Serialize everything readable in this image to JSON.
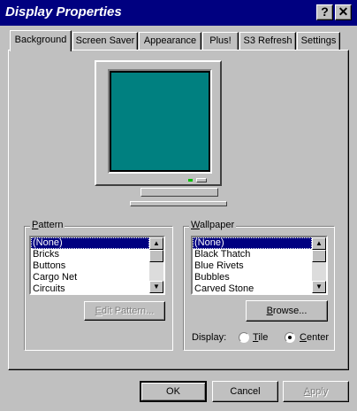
{
  "window": {
    "title": "Display Properties",
    "help_glyph": "?",
    "close_glyph": "✕"
  },
  "tabs": [
    {
      "label": "Background",
      "active": true
    },
    {
      "label": "Screen Saver",
      "active": false
    },
    {
      "label": "Appearance",
      "active": false
    },
    {
      "label": "Plus!",
      "active": false
    },
    {
      "label": "S3 Refresh",
      "active": false
    },
    {
      "label": "Settings",
      "active": false
    }
  ],
  "preview": {
    "screen_color": "#008080"
  },
  "pattern": {
    "group_label": "Pattern",
    "items": [
      "(None)",
      "Bricks",
      "Buttons",
      "Cargo Net",
      "Circuits"
    ],
    "selected": "(None)",
    "edit_button": "Edit Pattern..."
  },
  "wallpaper": {
    "group_label": "Wallpaper",
    "items": [
      "(None)",
      "Black Thatch",
      "Blue Rivets",
      "Bubbles",
      "Carved Stone"
    ],
    "selected": "(None)",
    "browse_button": "Browse...",
    "display_label": "Display:",
    "options": [
      {
        "label": "Tile",
        "checked": false
      },
      {
        "label": "Center",
        "checked": true
      }
    ]
  },
  "buttons": {
    "ok": "OK",
    "cancel": "Cancel",
    "apply": "Apply"
  },
  "colors": {
    "titlebar": "#000080",
    "face": "#c0c0c0",
    "selection": "#000080"
  }
}
